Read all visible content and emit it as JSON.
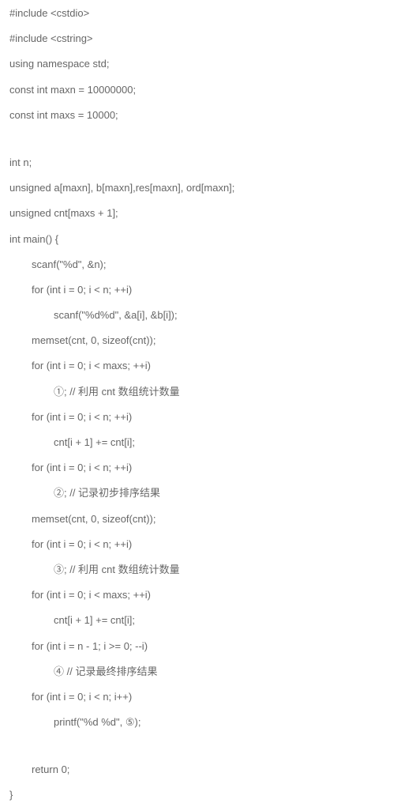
{
  "code": {
    "lines": [
      {
        "text": "#include <cstdio>",
        "indent": 0
      },
      {
        "text": "#include <cstring>",
        "indent": 0
      },
      {
        "text": "using namespace std;",
        "indent": 0
      },
      {
        "text": "const int maxn = 10000000;",
        "indent": 0
      },
      {
        "text": "const int maxs = 10000;",
        "indent": 0
      },
      {
        "text": "",
        "indent": 0,
        "blank": true
      },
      {
        "text": "int n;",
        "indent": 0
      },
      {
        "text": "unsigned a[maxn], b[maxn],res[maxn], ord[maxn];",
        "indent": 0
      },
      {
        "text": "unsigned cnt[maxs + 1];",
        "indent": 0
      },
      {
        "text": "int main() {",
        "indent": 0
      },
      {
        "text": "scanf(\"%d\", &n);",
        "indent": 1
      },
      {
        "text": "for (int i = 0; i < n; ++i)",
        "indent": 1
      },
      {
        "text": "scanf(\"%d%d\", &a[i], &b[i]);",
        "indent": 2
      },
      {
        "text": "memset(cnt, 0, sizeof(cnt));",
        "indent": 1
      },
      {
        "text": "for (int i = 0; i < maxs; ++i)",
        "indent": 1
      },
      {
        "text": "①; // 利用 cnt 数组统计数量",
        "indent": 2
      },
      {
        "text": "for (int i = 0; i < n; ++i)",
        "indent": 1
      },
      {
        "text": "cnt[i + 1] += cnt[i];",
        "indent": 2
      },
      {
        "text": "for (int i = 0; i < n; ++i)",
        "indent": 1
      },
      {
        "text": "②; // 记录初步排序结果",
        "indent": 2
      },
      {
        "text": "memset(cnt, 0, sizeof(cnt));",
        "indent": 1
      },
      {
        "text": "for (int i = 0; i < n; ++i)",
        "indent": 1
      },
      {
        "text": "③; // 利用 cnt 数组统计数量",
        "indent": 2
      },
      {
        "text": "for (int i = 0; i < maxs; ++i)",
        "indent": 1
      },
      {
        "text": "cnt[i + 1] += cnt[i];",
        "indent": 2
      },
      {
        "text": "for (int i = n - 1; i >= 0; --i)",
        "indent": 1
      },
      {
        "text": "④ // 记录最终排序结果",
        "indent": 2
      },
      {
        "text": "for (int i = 0; i < n; i++)",
        "indent": 1
      },
      {
        "text": "printf(\"%d %d\", ⑤);",
        "indent": 2
      },
      {
        "text": "",
        "indent": 0,
        "blank": true
      },
      {
        "text": "return 0;",
        "indent": 1
      },
      {
        "text": "}",
        "indent": 0
      }
    ]
  }
}
